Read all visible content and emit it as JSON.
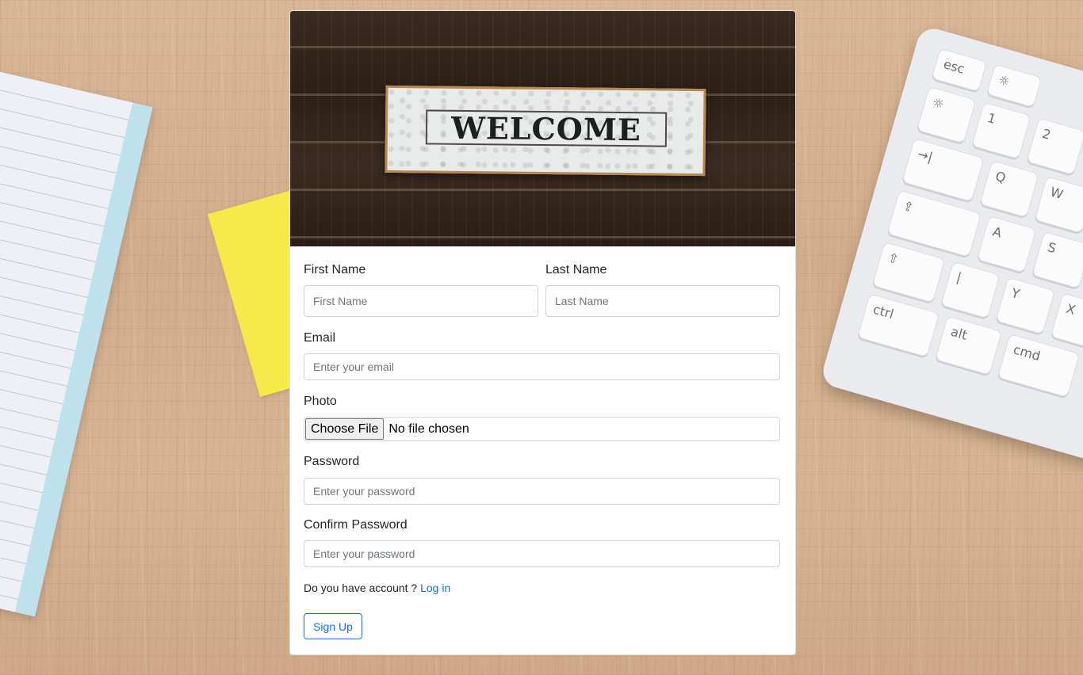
{
  "hero": {
    "sign_text": "WELCOME"
  },
  "form": {
    "first_name": {
      "label": "First Name",
      "placeholder": "First Name"
    },
    "last_name": {
      "label": "Last Name",
      "placeholder": "Last Name"
    },
    "email": {
      "label": "Email",
      "placeholder": "Enter your email"
    },
    "photo": {
      "label": "Photo",
      "button": "Choose File",
      "status": "No file chosen"
    },
    "password": {
      "label": "Password",
      "placeholder": "Enter your password"
    },
    "confirm_password": {
      "label": "Confirm Password",
      "placeholder": "Enter your password"
    },
    "account_prompt": "Do you have account ?",
    "login_link": "Log in",
    "submit": "Sign Up"
  },
  "keyboard": {
    "keys": [
      "esc",
      "☼",
      "1",
      "2",
      "→|",
      "Q",
      "W",
      "⇪",
      "A",
      "S",
      "⇧",
      "|",
      "Y",
      "X",
      "ctrl",
      "alt",
      "cmd"
    ]
  },
  "colors": {
    "accent": "#0d6efd",
    "sticky": "#f6e94a",
    "desk": "#d6b493"
  }
}
